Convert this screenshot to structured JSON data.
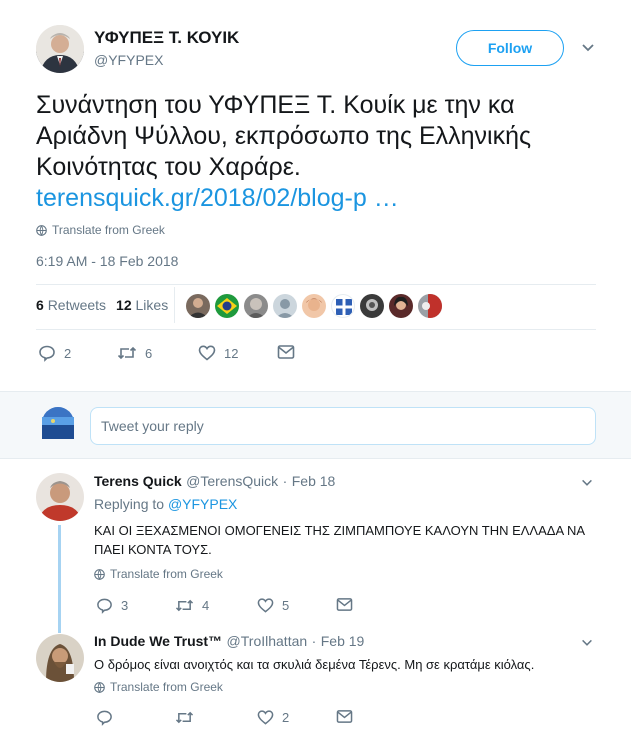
{
  "main_tweet": {
    "name": "ΥΦΥΠΕΞ Τ. ΚΟΥΙΚ",
    "handle": "@YFYPEX",
    "follow_label": "Follow",
    "text": "Συνάντηση του ΥΦΥΠΕΞ Τ. Κουίκ με την κα Αριάδνη Ψύλλου, εκπρόσωπο της Ελληνικής Κοινότητας του Χαράρε.",
    "link": "terensquick.gr/2018/02/blog-p …",
    "translate": "Translate from Greek",
    "timestamp": "6:19 AM - 18 Feb 2018",
    "retweets_count": "6",
    "retweets_label": "Retweets",
    "likes_count": "12",
    "likes_label": "Likes",
    "actions": {
      "replies": "2",
      "retweets": "6",
      "likes": "12"
    }
  },
  "reply_box": {
    "placeholder": "Tweet your reply"
  },
  "replies": [
    {
      "name": "Terens Quick",
      "handle": "@TerensQuick",
      "dot": "·",
      "date": "Feb 18",
      "replying_label": "Replying to",
      "replying_to": "@YFYPEX",
      "text": "ΚΑΙ ΟΙ ΞΕΧΑΣΜΕΝΟΙ ΟΜΟΓΕΝΕΙΣ ΤΗΣ ΖΙΜΠΑΜΠΟΥΕ ΚΑΛΟΥΝ ΤΗΝ ΕΛΛΑΔΑ ΝΑ ΠΑΕΙ ΚΟΝΤΑ ΤΟΥΣ.",
      "translate": "Translate from Greek",
      "actions": {
        "replies": "3",
        "retweets": "4",
        "likes": "5"
      }
    },
    {
      "name": "In Dude We Trust™",
      "handle": "@TroIlhattan",
      "dot": "·",
      "date": "Feb 19",
      "text": "Ο δρόμος είναι ανοιχτός και τα σκυλιά δεμένα Τέρενς. Μη σε κρατάμε κιόλας.",
      "translate": "Translate from Greek",
      "actions": {
        "replies": "",
        "retweets": "",
        "likes": "2"
      }
    }
  ],
  "colors": {
    "accent": "#1da1f2",
    "link": "#1b95e0",
    "muted": "#657786",
    "text": "#14171a"
  }
}
